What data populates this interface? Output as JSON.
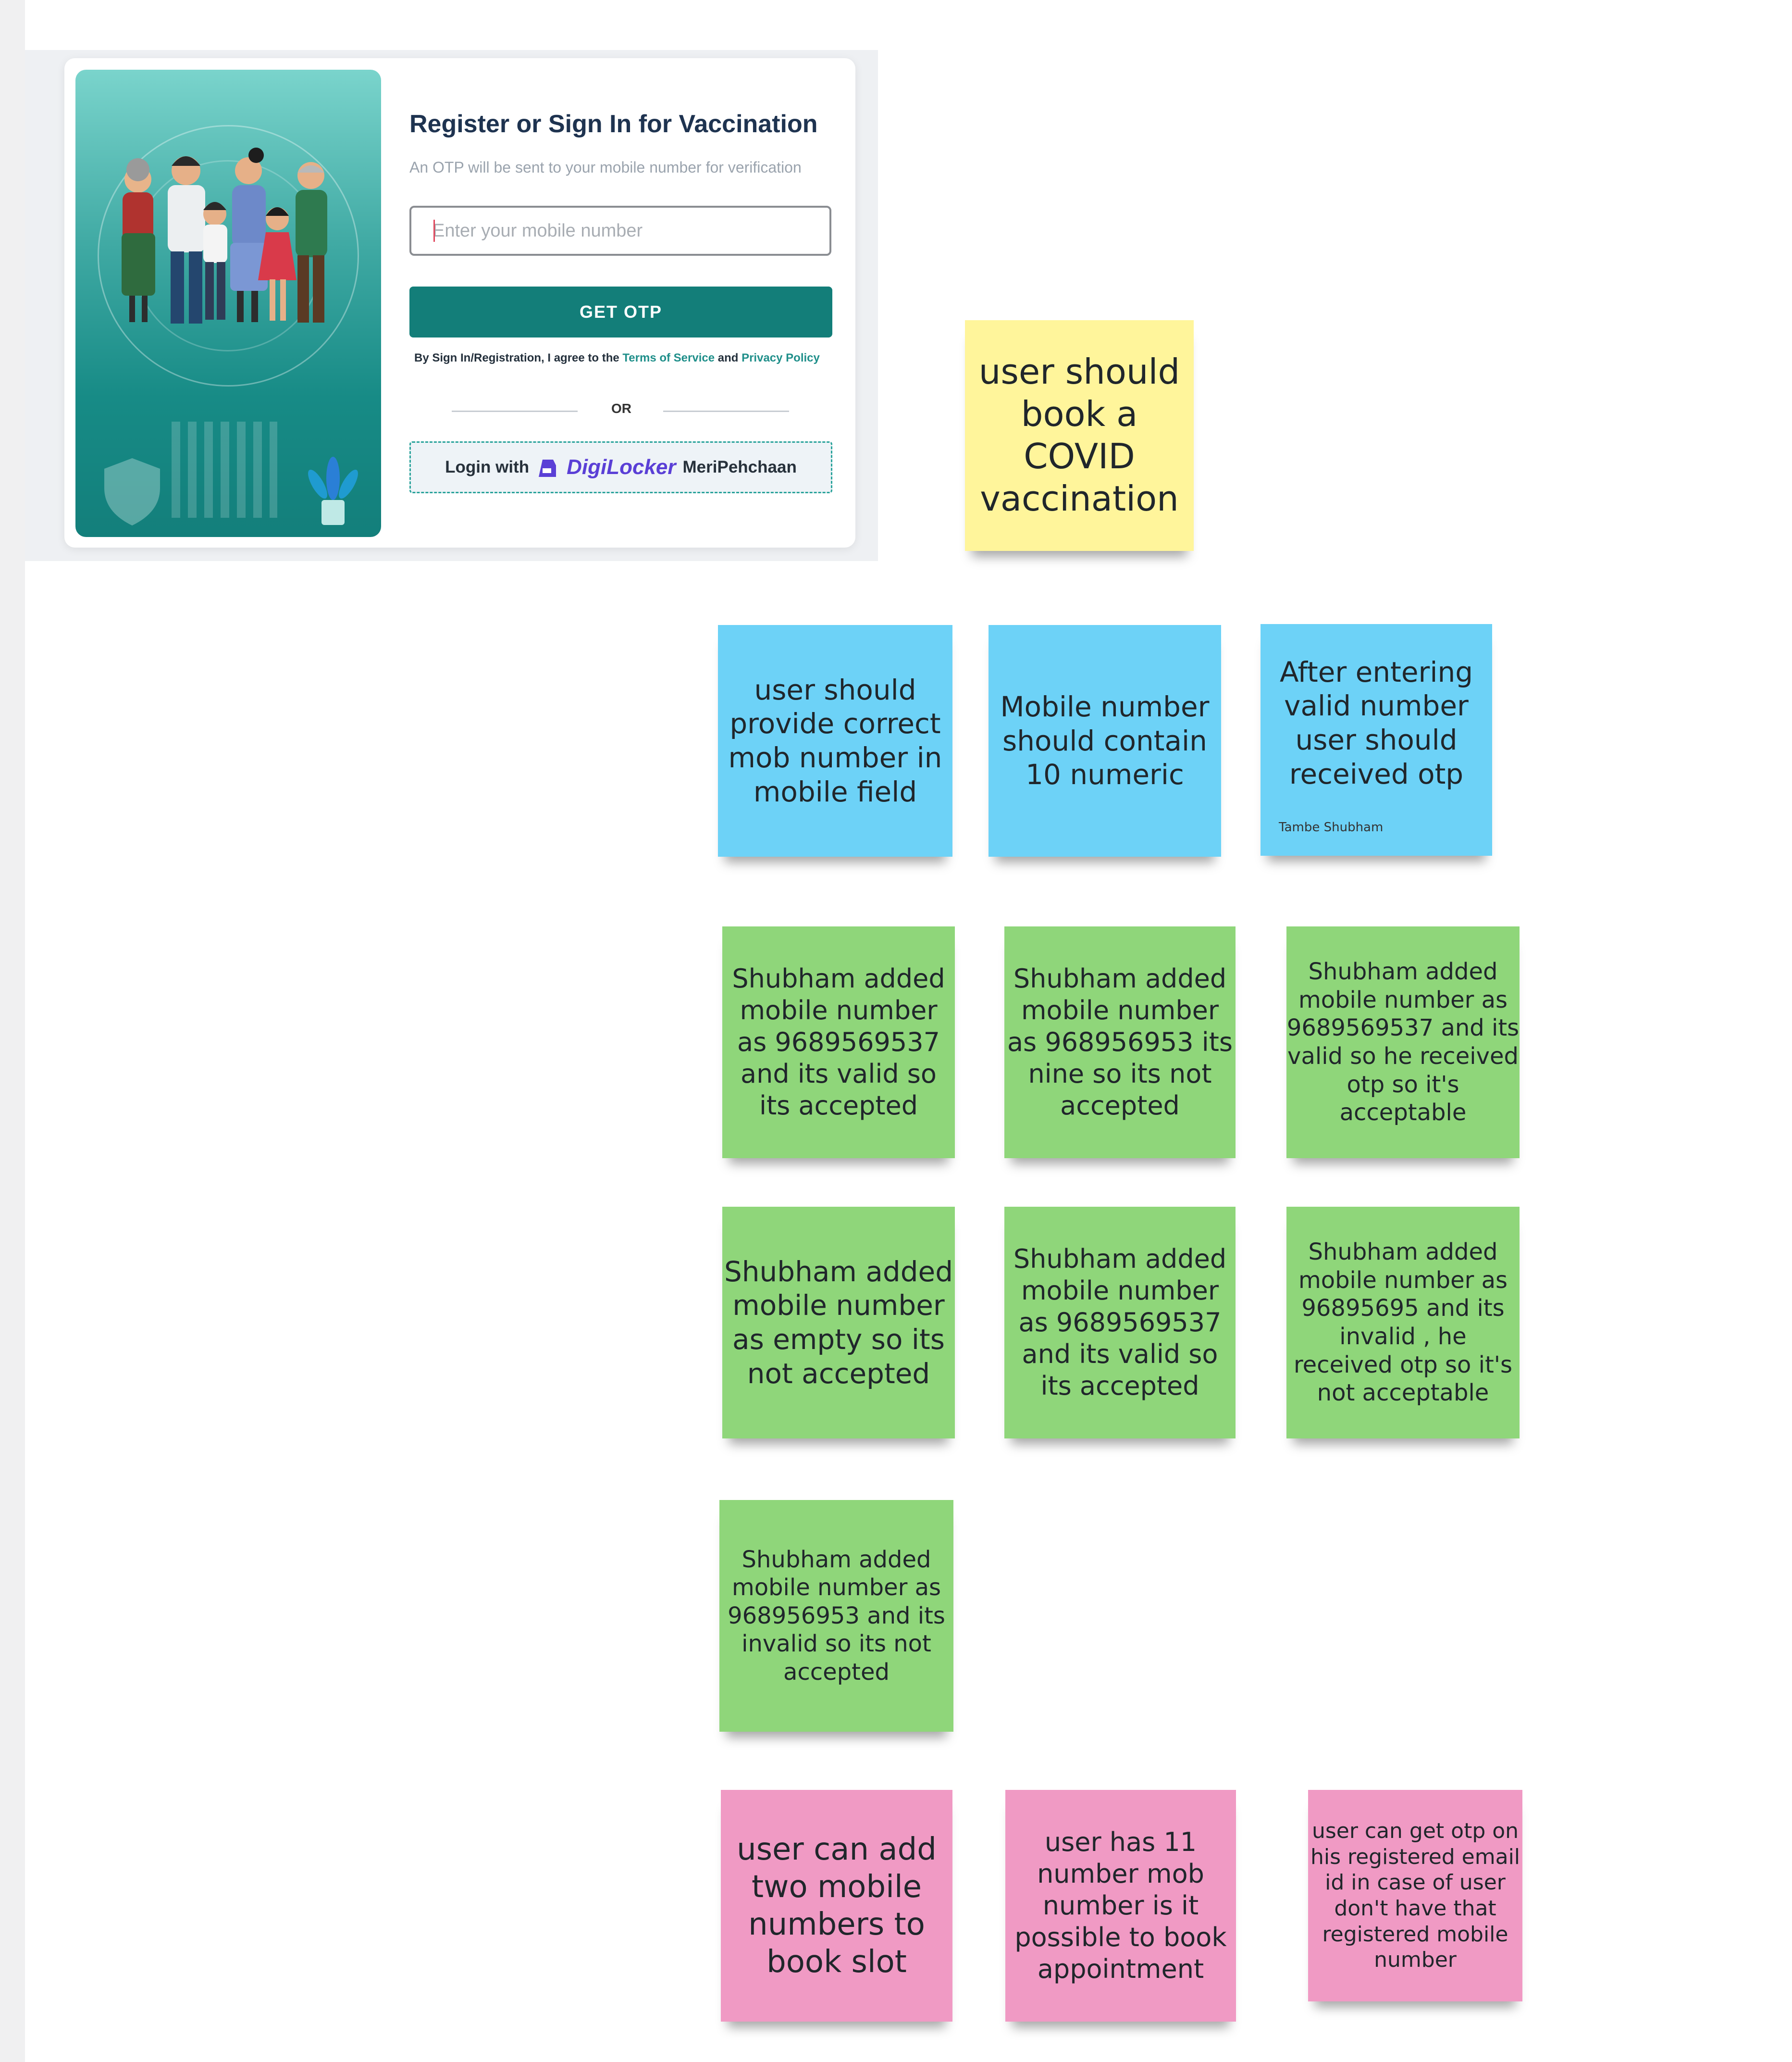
{
  "login_screen": {
    "title": "Register or Sign In for Vaccination",
    "subtitle": "An OTP will be sent to your mobile number for verification",
    "mobile_input": {
      "placeholder": "Enter your mobile number",
      "value": ""
    },
    "get_otp_button": "GET OTP",
    "terms": {
      "prefix": "By Sign In/Registration, I agree to the ",
      "terms_link": "Terms of Service",
      "and": " and ",
      "privacy_link": "Privacy Policy"
    },
    "or_divider": "OR",
    "digilocker_button": {
      "prefix": "Login with",
      "brand": "DigiLocker",
      "suffix": "MeriPehchaan"
    }
  },
  "colors": {
    "primary_teal": "#137e79",
    "note_yellow": "#fff59b",
    "note_blue": "#6dd2f7",
    "note_green": "#8fd67a",
    "note_pink": "#f09ac4"
  },
  "notes": {
    "user_story": "user should book a COVID vaccination",
    "requirements": [
      "user should provide correct mob number in mobile field",
      "Mobile number should contain 10 numeric",
      "After entering valid number user should received otp"
    ],
    "requirement_author": "Tambe Shubham",
    "test_cases": [
      "Shubham added mobile number as 9689569537 and its valid so its accepted",
      "Shubham added mobile number as 968956953 its nine  so its not accepted",
      "Shubham added mobile number as 9689569537 and its valid so he received otp so it's acceptable",
      "Shubham added mobile number as empty so its not accepted",
      "Shubham added mobile number as 9689569537 and its valid so its accepted",
      "Shubham added mobile number as 96895695 and its invalid , he received otp so it's not acceptable",
      "Shubham added mobile number as 968956953 and its invalid so its not accepted"
    ],
    "questions": [
      "user can add two mobile numbers to book slot",
      "user has 11 number mob number is it possible to book appointment",
      "user can get otp on his registered email id in case of user don't have that registered mobile number"
    ]
  }
}
